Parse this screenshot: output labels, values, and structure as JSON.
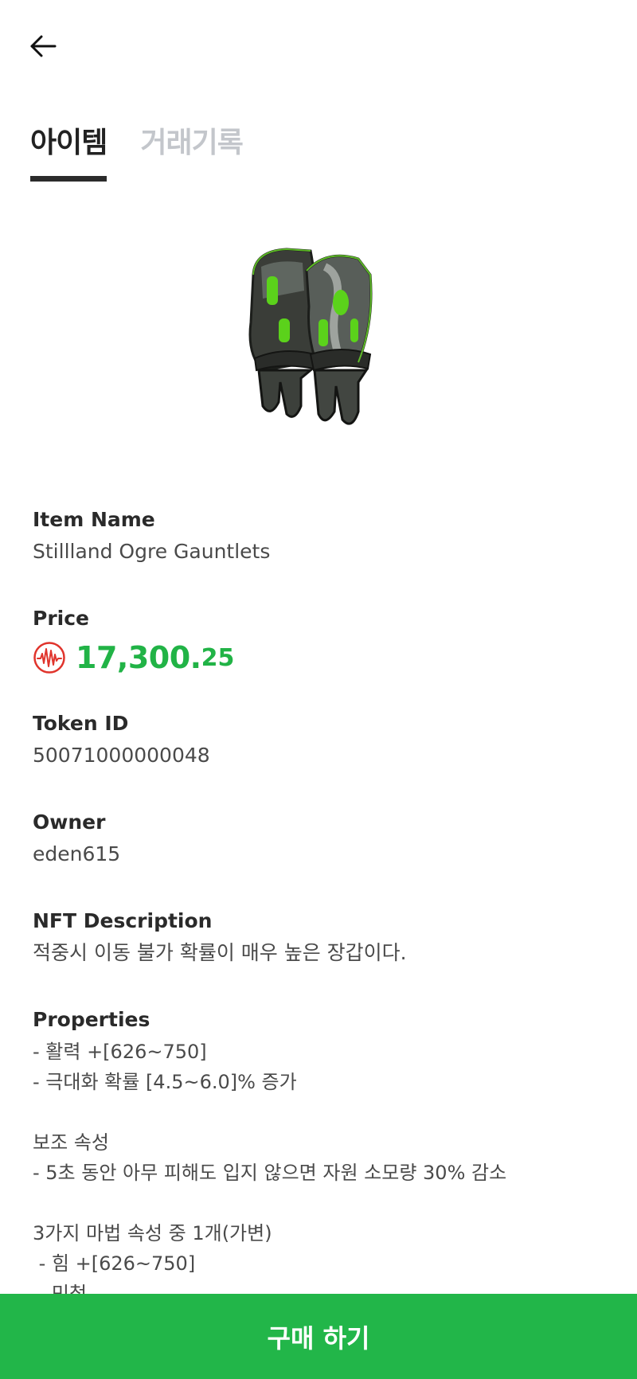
{
  "tabs": [
    {
      "label": "아이템",
      "active": true
    },
    {
      "label": "거래기록",
      "active": false
    }
  ],
  "item": {
    "image_icon": "green-gauntlets-image"
  },
  "fields": {
    "item_name_label": "Item Name",
    "item_name_value": "Stillland Ogre Gauntlets",
    "price_label": "Price",
    "price_main": "17,300.",
    "price_decimal": "25",
    "price_icon": "currency-waveform-icon",
    "token_label": "Token ID",
    "token_value": "50071000000048",
    "owner_label": "Owner",
    "owner_value": "eden615",
    "desc_label": "NFT Description",
    "desc_value": "적중시 이동 불가 확률이 매우 높은 장갑이다.",
    "props_label": "Properties"
  },
  "properties": {
    "main": [
      "- 활력 +[626~750]",
      "- 극대화 확률 [4.5~6.0]% 증가"
    ],
    "sub_title": "보조 속성",
    "sub": [
      "- 5초 동안 아무 피해도 입지 않으면 자원 소모량 30% 감소"
    ],
    "magic_title": "3가지 마법 속성 중 1개(가변)",
    "magic": [
      " - 힘 +[626~750]",
      " - 민첩"
    ]
  },
  "buy_button": {
    "label": "구매 하기"
  },
  "colors": {
    "accent": "#22b649",
    "price": "#21b346",
    "inactive_tab": "#c3c6cb"
  }
}
